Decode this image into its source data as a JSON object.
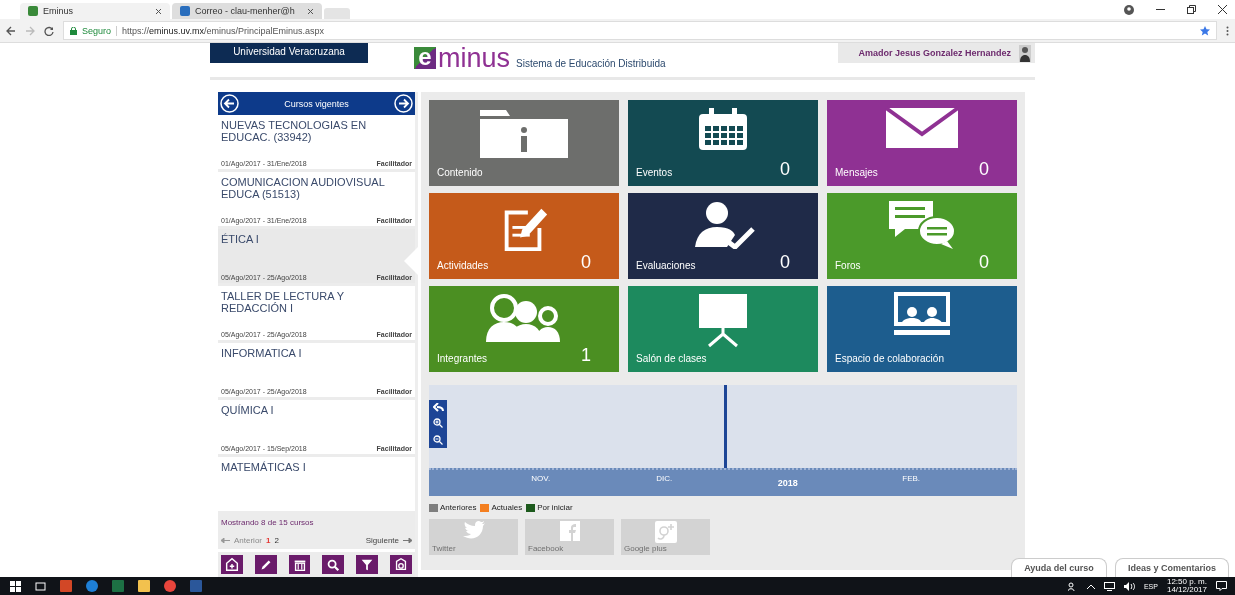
{
  "browser": {
    "tabs": [
      {
        "title": "Eminus",
        "selected": true
      },
      {
        "title": "Correo - clau-menher@h",
        "selected": false
      }
    ],
    "security": "Seguro",
    "url": "https://**eminus.uv.mx**/eminus/PrincipalEminus.aspx"
  },
  "header": {
    "university": "Universidad Veracruzana",
    "logo": {
      "mark": "e",
      "text": "minus"
    },
    "tagline": "Sistema de Educación Distribuida",
    "user": "Amador Jesus Gonzalez Hernandez"
  },
  "sidebar": {
    "title": "Cursos vigentes",
    "courses": [
      {
        "name": "NUEVAS TECNOLOGIAS EN EDUCAC. (33942)",
        "dates": "01/Ago/2017 - 31/Ene/2018",
        "role": "Facilitador",
        "selected": false
      },
      {
        "name": "COMUNICACION AUDIOVISUAL EDUCA (51513)",
        "dates": "01/Ago/2017 - 31/Ene/2018",
        "role": "Facilitador",
        "selected": false
      },
      {
        "name": "ÉTICA I",
        "dates": "05/Ago/2017 - 25/Ago/2018",
        "role": "Facilitador",
        "selected": true
      },
      {
        "name": "TALLER DE LECTURA Y REDACCIÓN I",
        "dates": "05/Ago/2017 - 25/Ago/2018",
        "role": "Facilitador",
        "selected": false
      },
      {
        "name": "INFORMATICA I",
        "dates": "05/Ago/2017 - 25/Ago/2018",
        "role": "Facilitador",
        "selected": false
      },
      {
        "name": "QUÍMICA I",
        "dates": "05/Ago/2017 - 15/Sep/2018",
        "role": "Facilitador",
        "selected": false
      },
      {
        "name": "MATEMÁTICAS I",
        "selected": false
      }
    ],
    "summary": "Mostrando 8 de 15 cursos",
    "pagination": {
      "previous": "Anterior",
      "previous_disabled": true,
      "pages": [
        {
          "label": "1",
          "selected": true
        },
        {
          "label": "2",
          "selected": false
        }
      ],
      "next": "Siguiente"
    }
  },
  "tiles": [
    {
      "label": "Contenido",
      "color": "#6d6e6c"
    },
    {
      "label": "Eventos",
      "count": "0",
      "color": "#134a52"
    },
    {
      "label": "Mensajes",
      "count": "0",
      "color": "#8f3193"
    },
    {
      "label": "Actividades",
      "count": "0",
      "color": "#c55a1a"
    },
    {
      "label": "Evaluaciones",
      "count": "0",
      "color": "#1f2a48"
    },
    {
      "label": "Foros",
      "count": "0",
      "color": "#4b9a2a"
    },
    {
      "label": "Integrantes",
      "count": "1",
      "color": "#4b8f22"
    },
    {
      "label": "Salón de clases",
      "color": "#1d8a5e"
    },
    {
      "label": "Espacio de colaboración",
      "color": "#1d5d8e"
    }
  ],
  "timeline": {
    "ticks": [
      "NOV.",
      "DIC.",
      "2018",
      "FEB."
    ],
    "legend": [
      {
        "label": "Anteriores",
        "color": "#7f7f7f"
      },
      {
        "label": "Actuales",
        "color": "#f47f20"
      },
      {
        "label": "Por iniciar",
        "color": "#1d5a1d"
      }
    ]
  },
  "social": [
    {
      "label": "Twitter"
    },
    {
      "label": "Facebook"
    },
    {
      "label": "Google plus"
    }
  ],
  "bottom_tabs": [
    {
      "label": "Ayuda del curso"
    },
    {
      "label": "Ideas y Comentarios"
    }
  ],
  "taskbar": {
    "language": "ESP",
    "time": "12:50 p. m.",
    "date": "14/12/2017"
  }
}
